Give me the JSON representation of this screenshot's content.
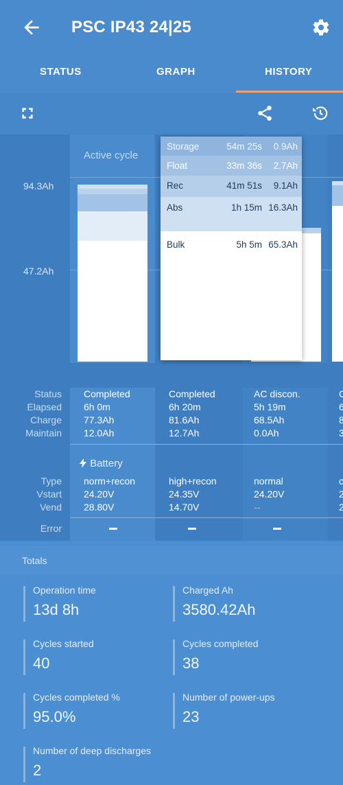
{
  "app": {
    "title": "PSC IP43 24|25"
  },
  "tabs": [
    {
      "label": "STATUS"
    },
    {
      "label": "GRAPH"
    },
    {
      "label": "HISTORY"
    }
  ],
  "colors": {
    "accent": "#f0a070",
    "appbar": "#4a8bcd",
    "chart_bg": "#3e7ec0"
  },
  "icons": {
    "back": "arrow-back-icon",
    "settings": "gear-icon",
    "fullscreen": "fullscreen-icon",
    "share": "share-icon",
    "history": "history-icon"
  },
  "chart": {
    "y_ticks": [
      "94.3Ah",
      "47.2Ah"
    ],
    "active_cycle_label": "Active cycle",
    "popup": [
      {
        "phase": "Storage",
        "duration": "54m 25s",
        "charge": "0.9Ah"
      },
      {
        "phase": "Float",
        "duration": "33m 36s",
        "charge": "2.7Ah"
      },
      {
        "phase": "Rec",
        "duration": "41m 51s",
        "charge": "9.1Ah"
      },
      {
        "phase": "Abs",
        "duration": "1h 15m",
        "charge": "16.3Ah"
      },
      {
        "phase": "Bulk",
        "duration": "5h 5m",
        "charge": "65.3Ah"
      }
    ]
  },
  "rows": {
    "status_label": "Status",
    "elapsed_label": "Elapsed",
    "charge_label": "Charge",
    "maintain_label": "Maintain",
    "battery_header": "Battery",
    "type_label": "Type",
    "vstart_label": "Vstart",
    "vend_label": "Vend",
    "error_label": "Error"
  },
  "cycles": [
    {
      "status": "Completed",
      "elapsed": "6h 0m",
      "charge": "77.3Ah",
      "maintain": "12.0Ah",
      "type": "norm+recon",
      "vstart": "24.20V",
      "vend": "28.80V"
    },
    {
      "status": "Completed",
      "elapsed": "6h 20m",
      "charge": "81.6Ah",
      "maintain": "12.7Ah",
      "type": "high+recon",
      "vstart": "24.35V",
      "vend": "14.70V"
    },
    {
      "status": "AC discon.",
      "elapsed": "5h 19m",
      "charge": "68.5Ah",
      "maintain": "0.0Ah",
      "type": "normal",
      "vstart": "24.20V",
      "vend": "--"
    },
    {
      "status": "C",
      "elapsed": "6",
      "charge": "8",
      "maintain": "3",
      "type": "c",
      "vstart": "2",
      "vend": "2"
    }
  ],
  "totals": {
    "title": "Totals",
    "items": [
      {
        "label": "Operation time",
        "value": "13d 8h"
      },
      {
        "label": "Charged Ah",
        "value": "3580.42Ah"
      },
      {
        "label": "Cycles started",
        "value": "40"
      },
      {
        "label": "Cycles completed",
        "value": "38"
      },
      {
        "label": "Cycles completed %",
        "value": "95.0%"
      },
      {
        "label": "Number of power-ups",
        "value": "23"
      },
      {
        "label": "Number of deep discharges",
        "value": "2"
      }
    ]
  }
}
